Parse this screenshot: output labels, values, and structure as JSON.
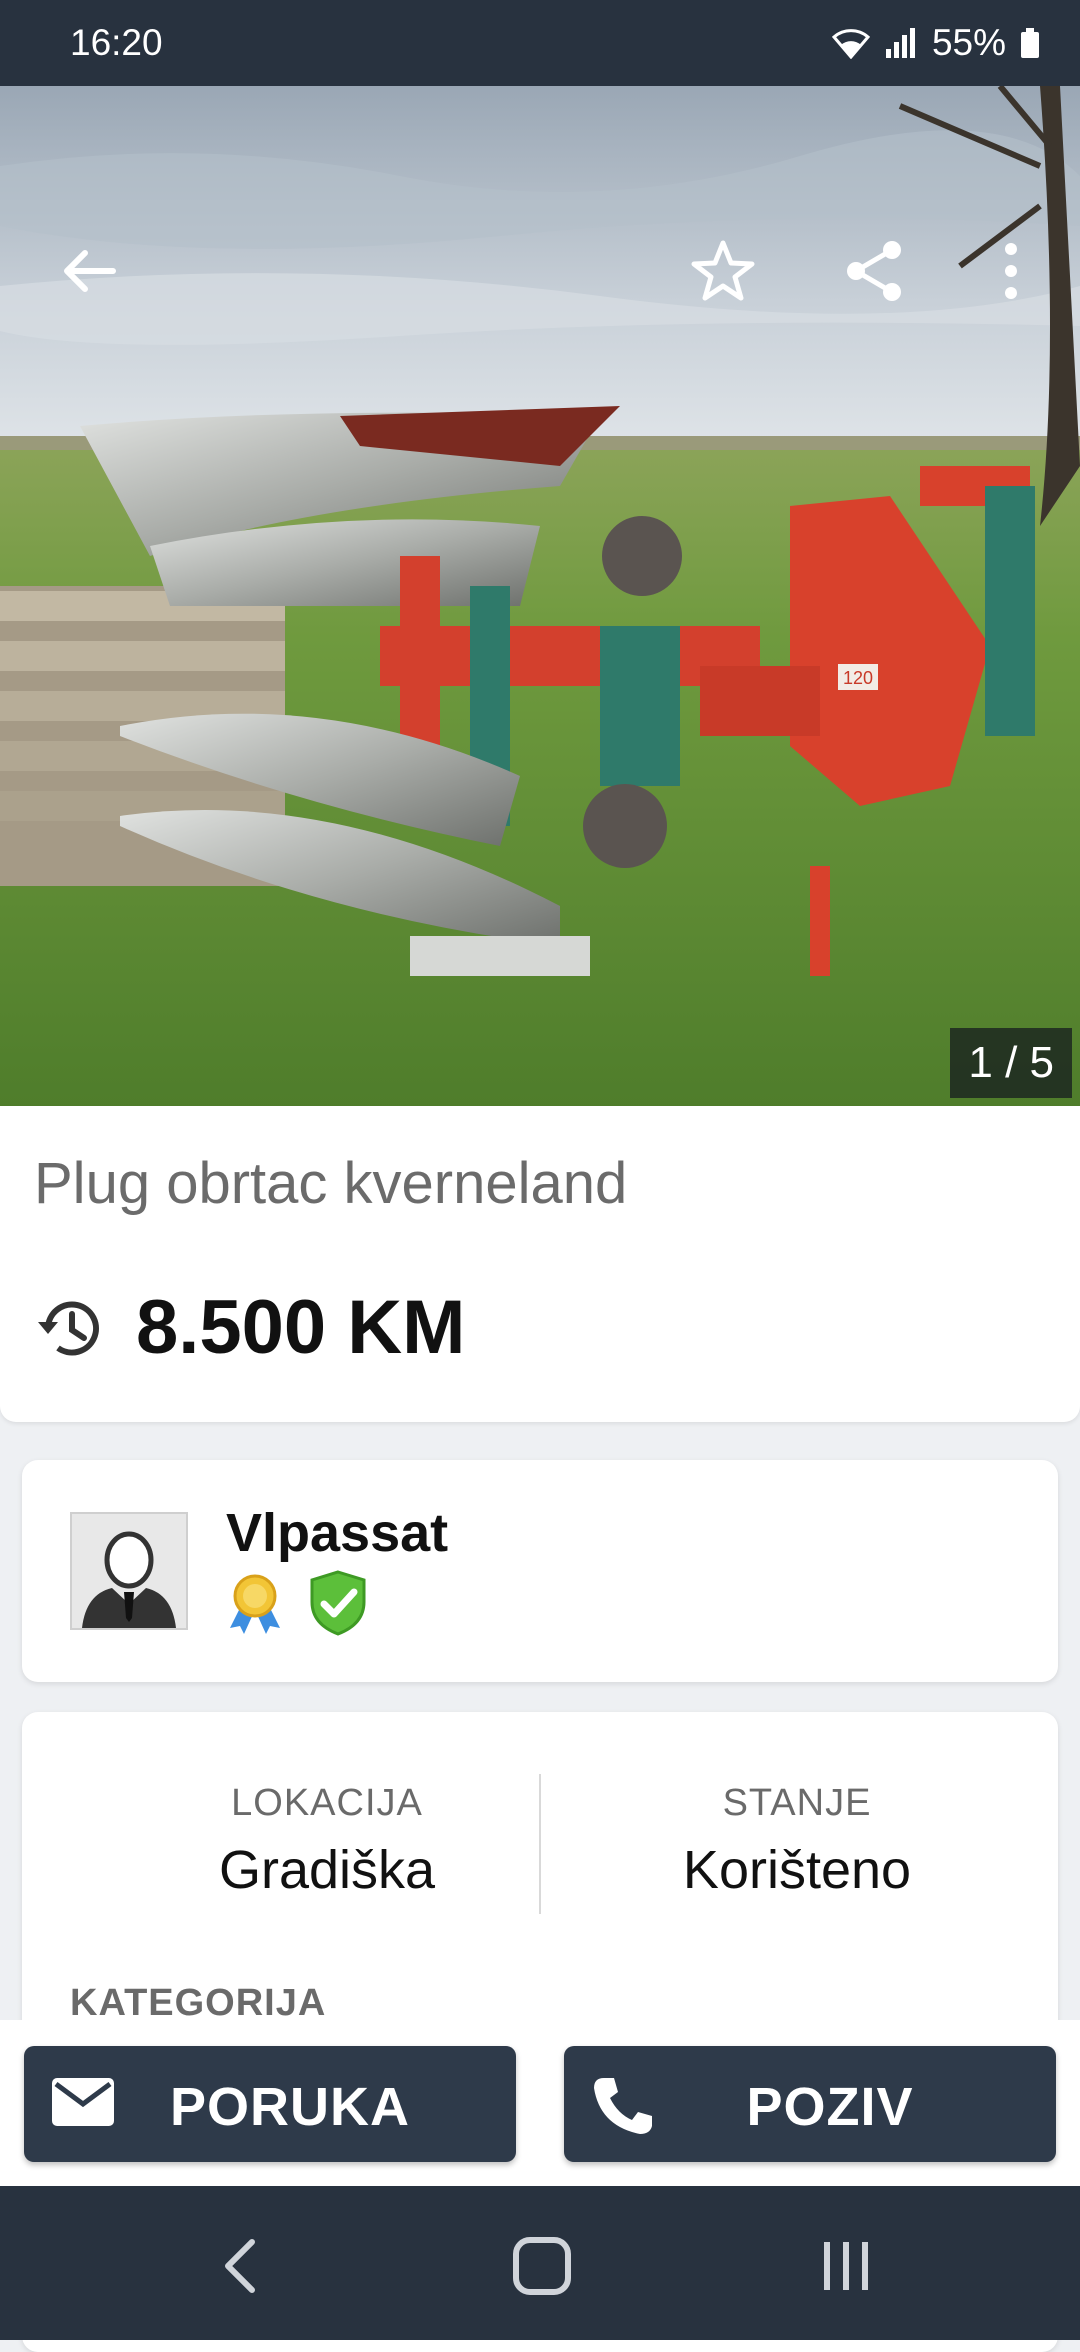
{
  "status_bar": {
    "time": "16:20",
    "battery": "55%",
    "icons": [
      "wifi-icon",
      "signal-icon",
      "battery-icon"
    ]
  },
  "gallery": {
    "counter": "1 / 5",
    "image_description_icon": "photo",
    "badge_text": "120"
  },
  "listing": {
    "title": "Plug obrtac kverneland",
    "price": "8.500 KM",
    "price_icon": "history-icon"
  },
  "seller": {
    "name": "Vlpassat",
    "badges": [
      "award-icon",
      "verified-shield-icon"
    ]
  },
  "details": {
    "location_label": "LOKACIJA",
    "location_value": "Gradiška",
    "condition_label": "STANJE",
    "condition_value": "Korišteno",
    "category_label": "KATEGORIJA"
  },
  "actions": {
    "message_label": "PORUKA",
    "call_label": "POZIV"
  },
  "colors": {
    "dark": "#28323f",
    "button": "#2e3a4a",
    "background": "#eef0f3"
  }
}
